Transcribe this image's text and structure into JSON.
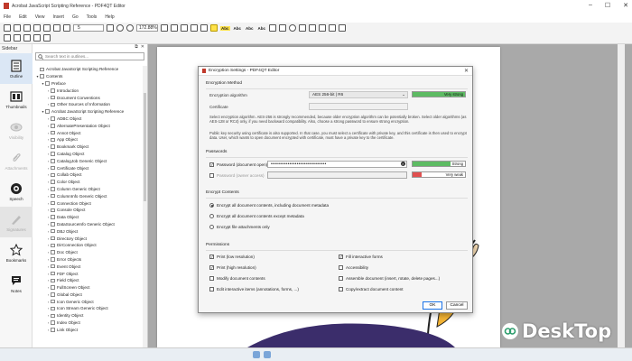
{
  "window": {
    "title": "Acrobat JavaScript Scripting Reference - PDF4QT Editor",
    "controls": [
      "minimize",
      "maximize",
      "close"
    ]
  },
  "menu": [
    "File",
    "Edit",
    "View",
    "Insert",
    "Go",
    "Tools",
    "Help"
  ],
  "toolbar": {
    "page_number": "5",
    "zoom": "172.88%",
    "text_tools": [
      "Abc",
      "Abc",
      "Abc",
      "Abc"
    ]
  },
  "sidebar": {
    "label": "Sidebar",
    "rail": [
      {
        "label": "Outline",
        "icon": "outline-icon",
        "active": true,
        "enabled": true
      },
      {
        "label": "Thumbnails",
        "icon": "thumbnails-icon",
        "active": false,
        "enabled": true
      },
      {
        "label": "Visibility",
        "icon": "visibility-icon",
        "active": false,
        "enabled": false
      },
      {
        "label": "Attachments",
        "icon": "attachments-icon",
        "active": false,
        "enabled": false
      },
      {
        "label": "Speech",
        "icon": "speech-icon",
        "active": false,
        "enabled": true
      },
      {
        "label": "Signatures",
        "icon": "signature-icon",
        "active": false,
        "enabled": false
      },
      {
        "label": "Bookmarks",
        "icon": "star-icon",
        "active": false,
        "enabled": true
      },
      {
        "label": "Notes",
        "icon": "notes-icon",
        "active": false,
        "enabled": true
      }
    ],
    "search_placeholder": "Search text in outlines..."
  },
  "outline": [
    {
      "label": "Acrobat JavaScript Scripting Reference",
      "level": 0,
      "arrow": ""
    },
    {
      "label": "Contents",
      "level": 0,
      "arrow": "v"
    },
    {
      "label": "Preface",
      "level": 1,
      "arrow": "v"
    },
    {
      "label": "Introduction",
      "level": 2,
      "arrow": ">"
    },
    {
      "label": "Document Conventions",
      "level": 2,
      "arrow": ">"
    },
    {
      "label": "Other Sources of Information",
      "level": 2,
      "arrow": ">"
    },
    {
      "label": "Acrobat JavaScript Scripting Reference",
      "level": 1,
      "arrow": "v"
    },
    {
      "label": "ADBC Object",
      "level": 2,
      "arrow": ">"
    },
    {
      "label": "AlternatePresentation Object",
      "level": 2,
      "arrow": ">"
    },
    {
      "label": "Annot Object",
      "level": 2,
      "arrow": ">"
    },
    {
      "label": "App Object",
      "level": 2,
      "arrow": ">"
    },
    {
      "label": "Bookmark Object",
      "level": 2,
      "arrow": ">"
    },
    {
      "label": "Catalog Object",
      "level": 2,
      "arrow": ">"
    },
    {
      "label": "CatalogJob Generic Object",
      "level": 2,
      "arrow": ">"
    },
    {
      "label": "Certificate Object",
      "level": 2,
      "arrow": ">"
    },
    {
      "label": "Collab Object",
      "level": 2,
      "arrow": ">"
    },
    {
      "label": "Color Object",
      "level": 2,
      "arrow": ">"
    },
    {
      "label": "Column Generic Object",
      "level": 2,
      "arrow": ">"
    },
    {
      "label": "ColumnInfo Generic Object",
      "level": 2,
      "arrow": ">"
    },
    {
      "label": "Connection Object",
      "level": 2,
      "arrow": ">"
    },
    {
      "label": "Console Object",
      "level": 2,
      "arrow": ">"
    },
    {
      "label": "Data Object",
      "level": 2,
      "arrow": ">"
    },
    {
      "label": "DataSourceInfo Generic Object",
      "level": 2,
      "arrow": ">"
    },
    {
      "label": "DBJ Object",
      "level": 2,
      "arrow": ">"
    },
    {
      "label": "Directory Object",
      "level": 2,
      "arrow": ">"
    },
    {
      "label": "DirConnection Object",
      "level": 2,
      "arrow": ">"
    },
    {
      "label": "Doc Object",
      "level": 2,
      "arrow": ">"
    },
    {
      "label": "Error Objects",
      "level": 2,
      "arrow": ">"
    },
    {
      "label": "Event Object",
      "level": 2,
      "arrow": ">"
    },
    {
      "label": "FDF Object",
      "level": 2,
      "arrow": ">"
    },
    {
      "label": "Field Object",
      "level": 2,
      "arrow": ">"
    },
    {
      "label": "FullScreen Object",
      "level": 2,
      "arrow": ">"
    },
    {
      "label": "Global Object",
      "level": 2,
      "arrow": ">"
    },
    {
      "label": "Icon Generic Object",
      "level": 2,
      "arrow": ">"
    },
    {
      "label": "Icon Stream Generic Object",
      "level": 2,
      "arrow": ">"
    },
    {
      "label": "Identity Object",
      "level": 2,
      "arrow": ">"
    },
    {
      "label": "Index Object",
      "level": 2,
      "arrow": ">"
    },
    {
      "label": "Link Object",
      "level": 2,
      "arrow": ">"
    }
  ],
  "document": {
    "visible_text": [
      "ot",
      "ce"
    ]
  },
  "dialog": {
    "title": "Encryption Settings - PDF4QT Editor",
    "encryption_method": {
      "heading": "Encryption Method",
      "algorithm_label": "Encryption algorithm",
      "algorithm_value": "AES 256-bit | R6",
      "strength_text": "Very strong",
      "strength_fraction": 1.0,
      "certificate_label": "Certificate",
      "certificate_value": "",
      "description_1": "Select encryption algorithm. AES-256 is strongly recommended, because older encryption algorithm can be potentially broken. Select older algorithms (as AES-128 or RC4) only, if you need backward compatibility. Also, choose a strong password to ensure strong encryption.",
      "description_2": "Public key security using certificate is also supported. In that case, you must select a certificate with private key, and this certificate is then used to encrypt data. User, which wants to open document encrypted with certificate, must have a private key to the certificate."
    },
    "passwords": {
      "heading": "Passwords",
      "open_label": "Password (document open)",
      "open_checked": true,
      "open_value": "••••••••••••••••••••••••••••••",
      "open_strength": "Strong",
      "open_strength_fraction": 0.72,
      "owner_label": "Password (owner access)",
      "owner_checked": false,
      "owner_value": "",
      "owner_strength": "Very weak",
      "owner_strength_fraction": 0.18
    },
    "encrypt_contents": {
      "heading": "Encrypt Contents",
      "options": [
        {
          "label": "Encrypt all document contents, including document metadata",
          "selected": true
        },
        {
          "label": "Encrypt all document contents except metadata",
          "selected": false
        },
        {
          "label": "Encrypt file attachments only",
          "selected": false
        }
      ]
    },
    "permissions": {
      "heading": "Permissions",
      "left": [
        {
          "label": "Print (low resolution)",
          "checked": true
        },
        {
          "label": "Print (high resolution)",
          "checked": true
        },
        {
          "label": "Modify document contents",
          "checked": false
        },
        {
          "label": "Edit interactive items (annotations, forms, ...)",
          "checked": false
        }
      ],
      "right": [
        {
          "label": "Fill interactive forms",
          "checked": true
        },
        {
          "label": "Accessibility",
          "checked": false
        },
        {
          "label": "Assemble document (insert, rotate, delete pages...)",
          "checked": false
        },
        {
          "label": "Copy/extract document content",
          "checked": false
        }
      ]
    },
    "ok_label": "OK",
    "cancel_label": "Cancel"
  },
  "watermark": "DeskTop",
  "colors": {
    "accent": "#1a73e8",
    "meter_green": "#5dbb63",
    "meter_red": "#e05050",
    "doc_text": "#2b3c9e"
  }
}
